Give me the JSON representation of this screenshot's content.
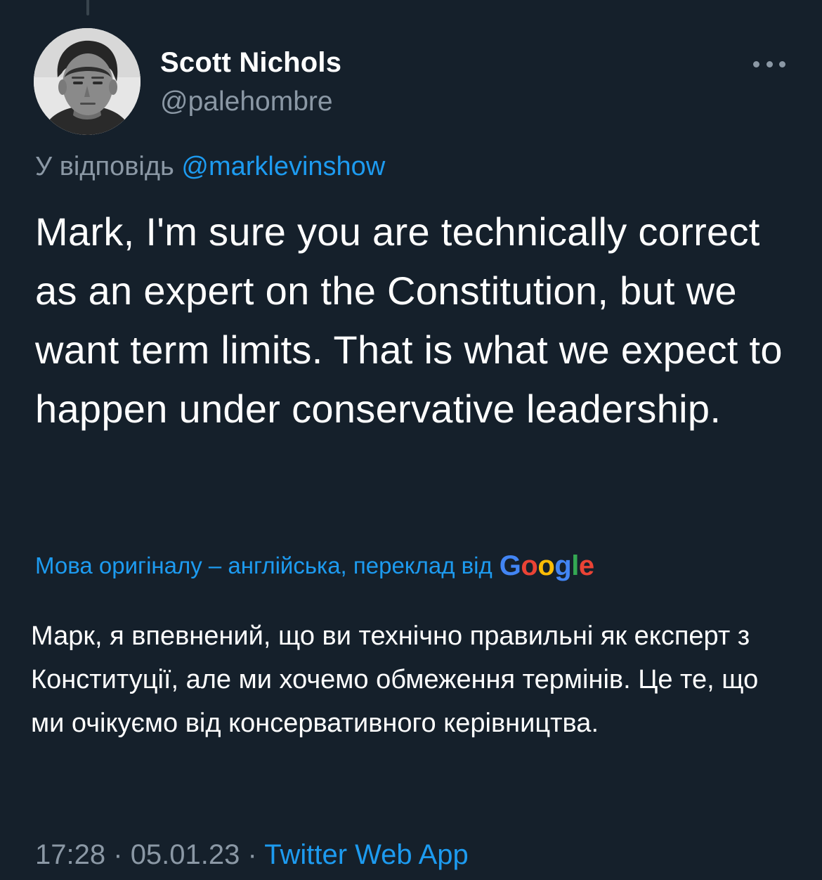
{
  "author": {
    "display_name": "Scott Nichols",
    "handle": "@palehombre"
  },
  "reply": {
    "prefix": "У відповідь",
    "handle": "@marklevinshow"
  },
  "tweet": {
    "text": "Mark, I'm sure you are technically correct as an expert on the Constitution, but we want term limits. That is what we expect to happen under conservative leadership."
  },
  "translation": {
    "label": "Мова оригіналу – англійська, переклад від",
    "provider": "Google",
    "text": "Марк, я впевнений, що ви технічно правильні як експерт з Конституції, але ми хочемо обмеження термінів. Це те, що ми очікуємо від консервативного керівництва."
  },
  "meta": {
    "time": "17:28",
    "separator": "·",
    "date": "05.01.23",
    "source": "Twitter Web App"
  },
  "icons": {
    "more": "more-horizontal-icon",
    "avatar": "profile-photo"
  },
  "colors": {
    "background": "#15202b",
    "link": "#1d9bf0",
    "secondary_text": "#8b98a5",
    "primary_text": "#ffffff"
  }
}
